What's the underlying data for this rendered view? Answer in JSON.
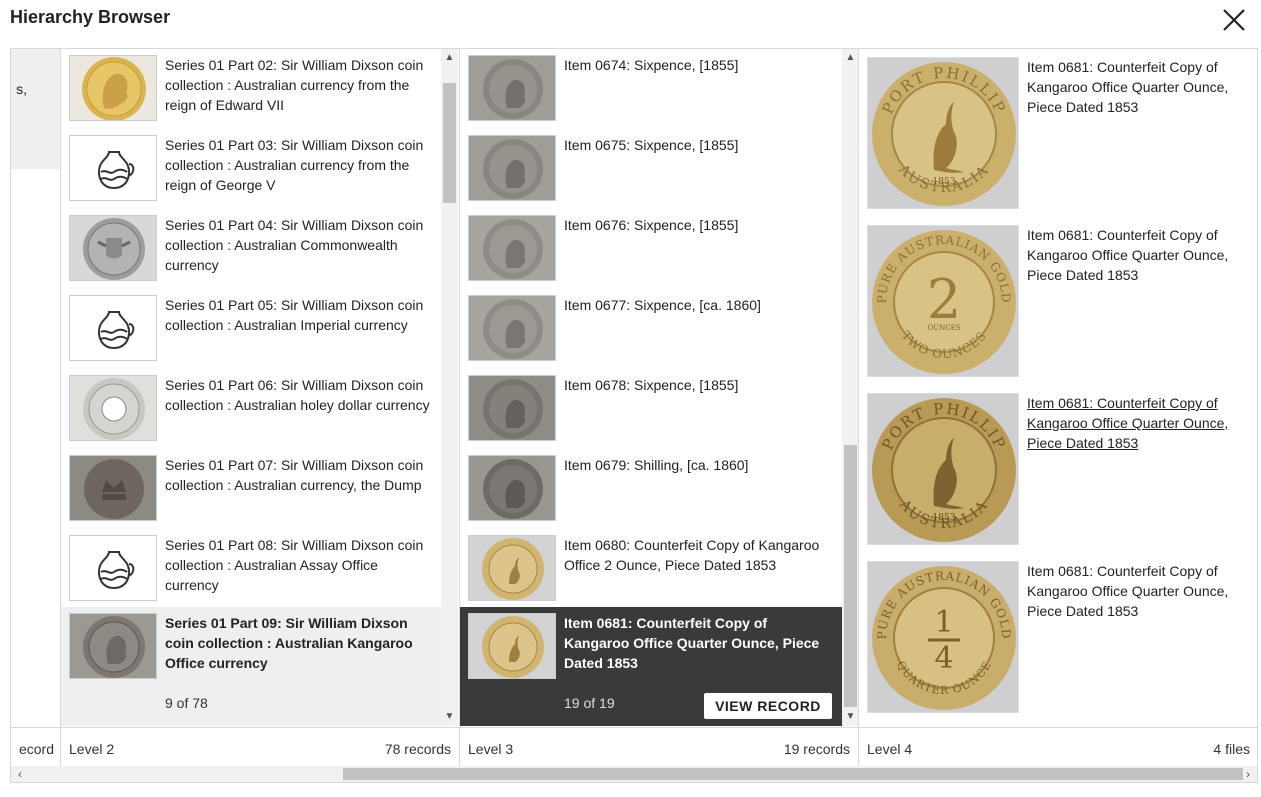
{
  "title": "Hierarchy Browser",
  "close_icon": "close-icon",
  "level1": {
    "fragment": "s,",
    "footer_label": "ecord"
  },
  "level2": {
    "footer_label": "Level 2",
    "footer_count": "78 records",
    "items": [
      {
        "label": "Series 01 Part 02: Sir William Dixson coin collection : Australian currency from the reign of Edward VII",
        "thumb": "gold-head-coin"
      },
      {
        "label": "Series 01 Part 03: Sir William Dixson coin collection : Australian currency from the reign of George V",
        "thumb": "jug-icon"
      },
      {
        "label": "Series 01 Part 04: Sir William Dixson coin collection : Australian Commonwealth currency",
        "thumb": "silver-arms-coin"
      },
      {
        "label": "Series 01 Part 05: Sir William Dixson coin collection : Australian Imperial currency",
        "thumb": "jug-icon"
      },
      {
        "label": "Series 01 Part 06: Sir William Dixson coin collection : Australian holey dollar currency",
        "thumb": "holey-dollar-coin"
      },
      {
        "label": "Series 01 Part 07: Sir William Dixson coin collection : Australian currency, the Dump",
        "thumb": "dump-coin"
      },
      {
        "label": "Series 01 Part 08: Sir William Dixson coin collection : Australian Assay Office currency",
        "thumb": "jug-icon"
      }
    ],
    "selected": {
      "label": "Series 01 Part 09: Sir William Dixson coin collection : Australian Kangaroo Office currency",
      "count": "9 of 78"
    }
  },
  "level3": {
    "footer_label": "Level 3",
    "footer_count": "19 records",
    "items": [
      {
        "label": "Item 0674: Sixpence, [1855]"
      },
      {
        "label": "Item 0675: Sixpence, [1855]"
      },
      {
        "label": "Item 0676: Sixpence, [1855]"
      },
      {
        "label": "Item 0677: Sixpence, [ca. 1860]"
      },
      {
        "label": "Item 0678: Sixpence, [1855]"
      },
      {
        "label": "Item 0679: Shilling, [ca. 1860]"
      },
      {
        "label": "Item 0680: Counterfeit Copy of Kangaroo Office 2 Ounce, Piece Dated 1853"
      }
    ],
    "selected": {
      "label": "Item 0681: Counterfeit Copy of Kangaroo Office Quarter Ounce, Piece Dated 1853",
      "count": "19 of 19",
      "button": "VIEW RECORD"
    }
  },
  "level4": {
    "footer_label": "Level 4",
    "footer_count": "4 files",
    "files": [
      {
        "label": "Item 0681: Counterfeit Copy of Kangaroo Office Quarter Ounce, Piece Dated 1853"
      },
      {
        "label": "Item 0681: Counterfeit Copy of Kangaroo Office Quarter Ounce, Piece Dated 1853"
      },
      {
        "label": "Item 0681: Counterfeit Copy of Kangaroo Office Quarter Ounce, Piece Dated 1853"
      },
      {
        "label": "Item 0681: Counterfeit Copy of Kangaroo Office Quarter Ounce, Piece Dated 1853"
      }
    ],
    "coin_text": {
      "port_phillip": "PORT PHILLIP",
      "australia": "AUSTRALIA",
      "year": "1853",
      "pure_gold": "PURE AUSTRALIAN GOLD",
      "two": "2",
      "ounces": "OUNCES",
      "two_ounces": "TWO OUNCES",
      "quarter_num": "1",
      "quarter_den": "4",
      "quarter_ounce": "QUARTER OUNCE"
    }
  },
  "colors": {
    "selected_dark": "#3a3a3a",
    "selected_light": "#efefef",
    "gold": "#d7bf7a"
  }
}
